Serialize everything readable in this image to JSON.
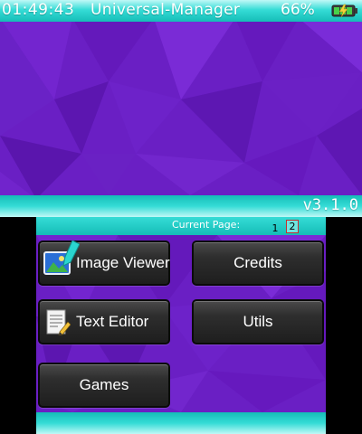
{
  "status_bar": {
    "time": "01:49:43",
    "title": "Universal-Manager",
    "battery_percent": "66%",
    "battery_icon": "battery-charging-icon"
  },
  "version_bar": {
    "version": "v3.1.0"
  },
  "pager": {
    "label": "Current Page:",
    "pages": [
      "1",
      "2"
    ],
    "current_page": "2"
  },
  "menu": {
    "image_viewer": {
      "label": "Image Viewer",
      "icon": "image-icon"
    },
    "credits": {
      "label": "Credits"
    },
    "text_editor": {
      "label": "Text Editor",
      "icon": "notepad-icon"
    },
    "utils": {
      "label": "Utils"
    },
    "games": {
      "label": "Games"
    }
  },
  "selection_indicator": "cursor-arrow-icon",
  "colors": {
    "accent": "#2ad6d0",
    "wallpaper": "#6a1fc4",
    "button": "#2e2e2e",
    "page_highlight": "#c43030"
  }
}
